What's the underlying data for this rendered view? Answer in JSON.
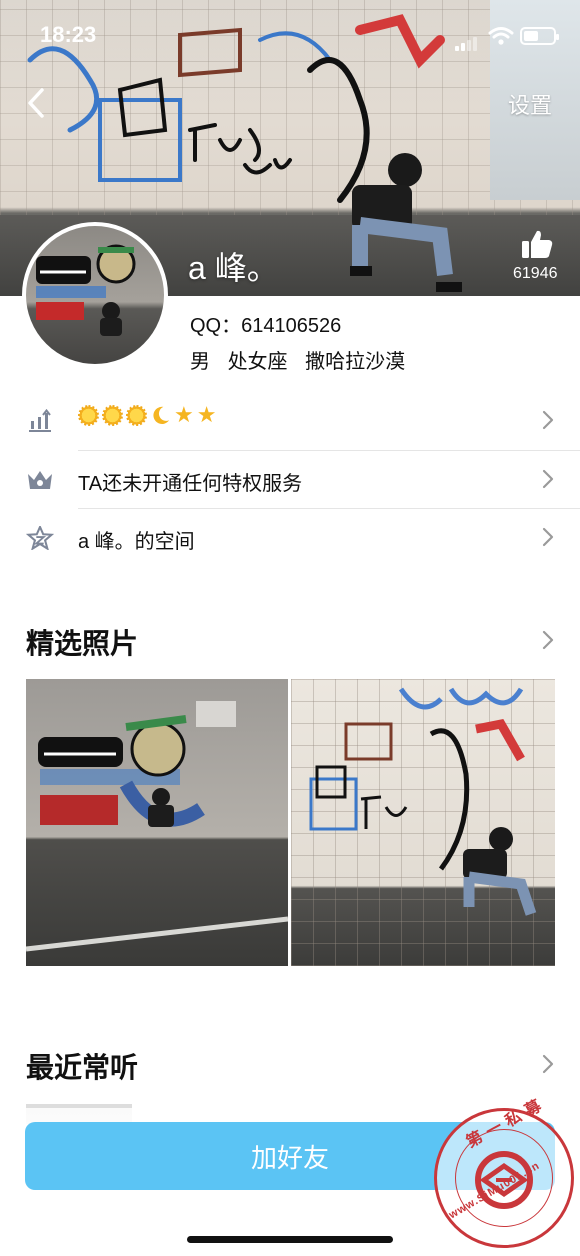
{
  "status_bar": {
    "time": "18:23"
  },
  "header": {
    "settings_label": "设置",
    "nickname": "a 峰。",
    "like_count": "61946"
  },
  "profile": {
    "qq": "QQ：614106526",
    "gender": "男",
    "zodiac": "处女座",
    "location": "撒哈拉沙漠"
  },
  "rows": {
    "privilege": "TA还未开通任何特权服务",
    "space": "a 峰。的空间"
  },
  "sections": {
    "photos_title": "精选照片",
    "music_title": "最近常听"
  },
  "actions": {
    "add_friend": "加好友"
  },
  "watermark": {
    "top": "第一私募",
    "bottom": "www.SiMu001.cn"
  },
  "colors": {
    "accent": "#5bc4f4",
    "watermark": "#c9373b",
    "star": "#f5b521"
  }
}
